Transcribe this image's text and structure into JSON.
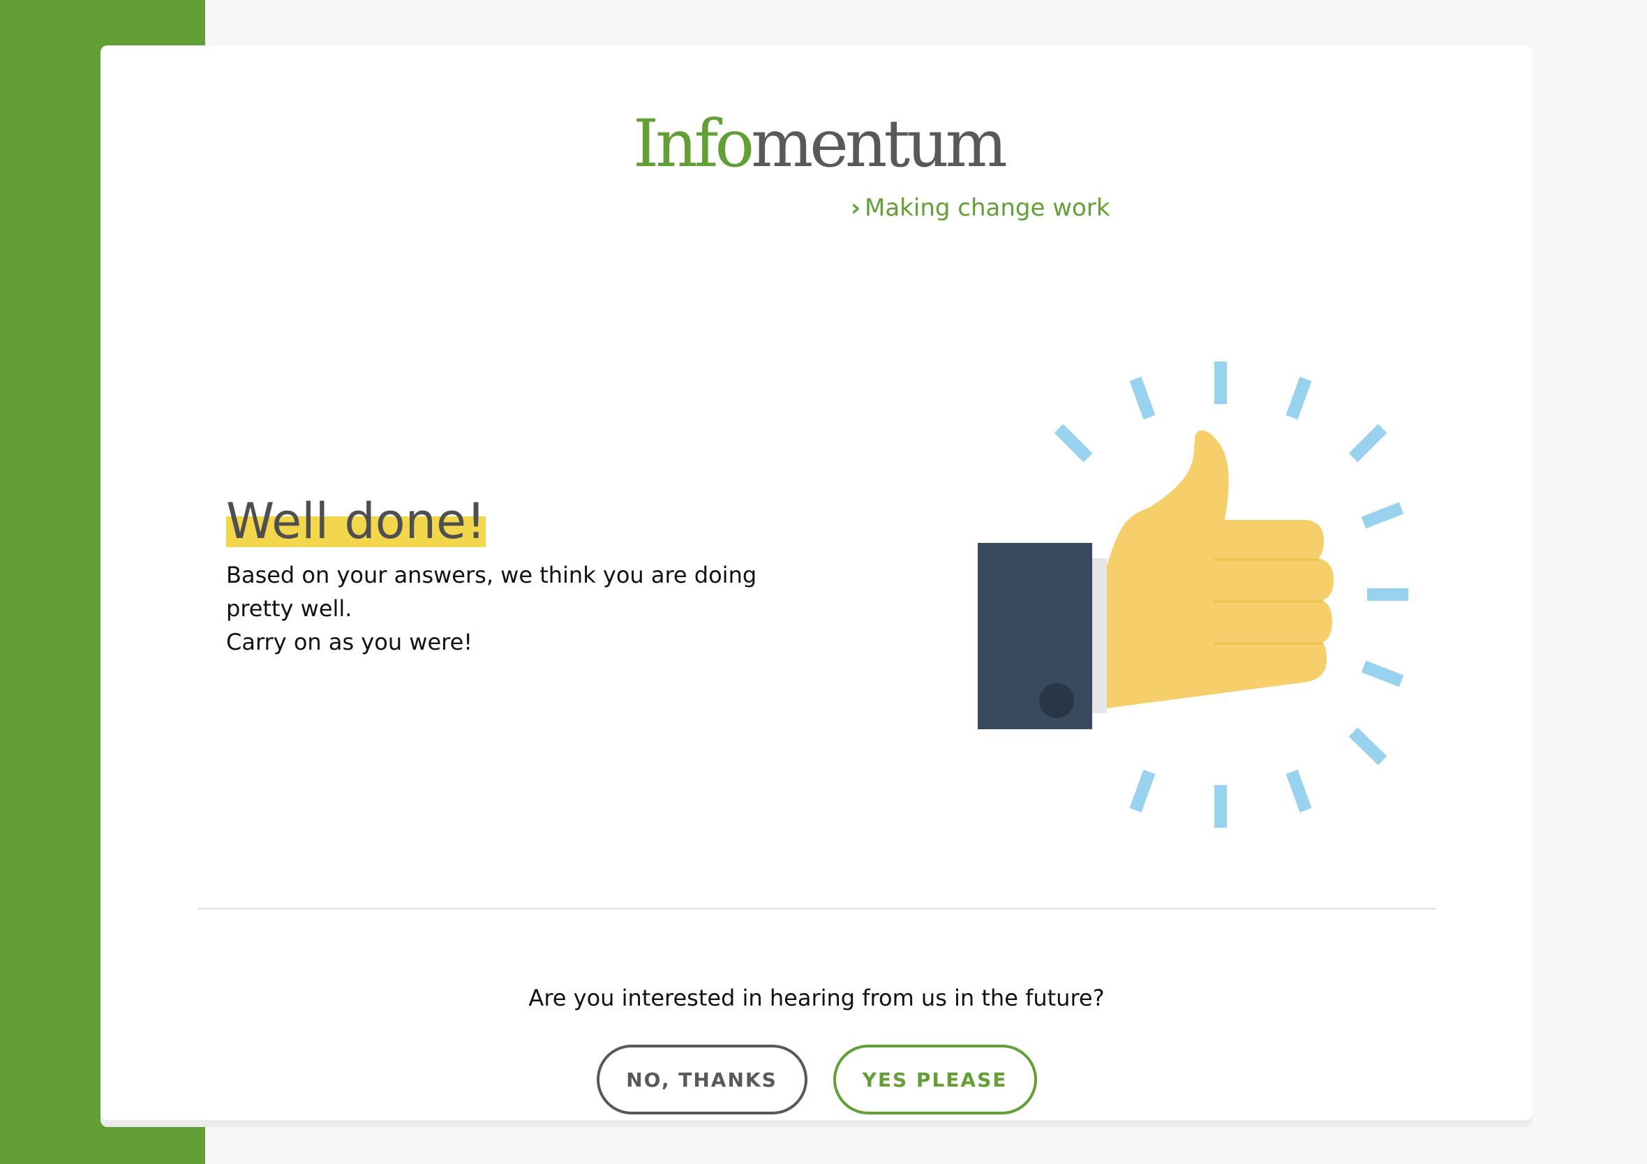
{
  "brand": {
    "name_part_1": "Info",
    "name_part_2": "mentum",
    "tagline": "Making change work"
  },
  "result": {
    "title": "Well done!",
    "message_line_1": "Based on your answers, we think you are doing pretty well.",
    "message_line_2": "Carry on as you were!"
  },
  "followup": {
    "question": "Are you interested in hearing from us in the future?",
    "no_label": "NO, THANKS",
    "yes_label": "YES PLEASE"
  },
  "colors": {
    "brand_green": "#62a036",
    "highlight_yellow": "#f2d64b",
    "thumb_yellow": "#f6cf6a",
    "sleeve_navy": "#384a5e",
    "ray_blue": "#93d0ef"
  },
  "icons": {
    "illustration": "thumbs-up-icon",
    "tagline_marker": "chevron-right-icon"
  }
}
